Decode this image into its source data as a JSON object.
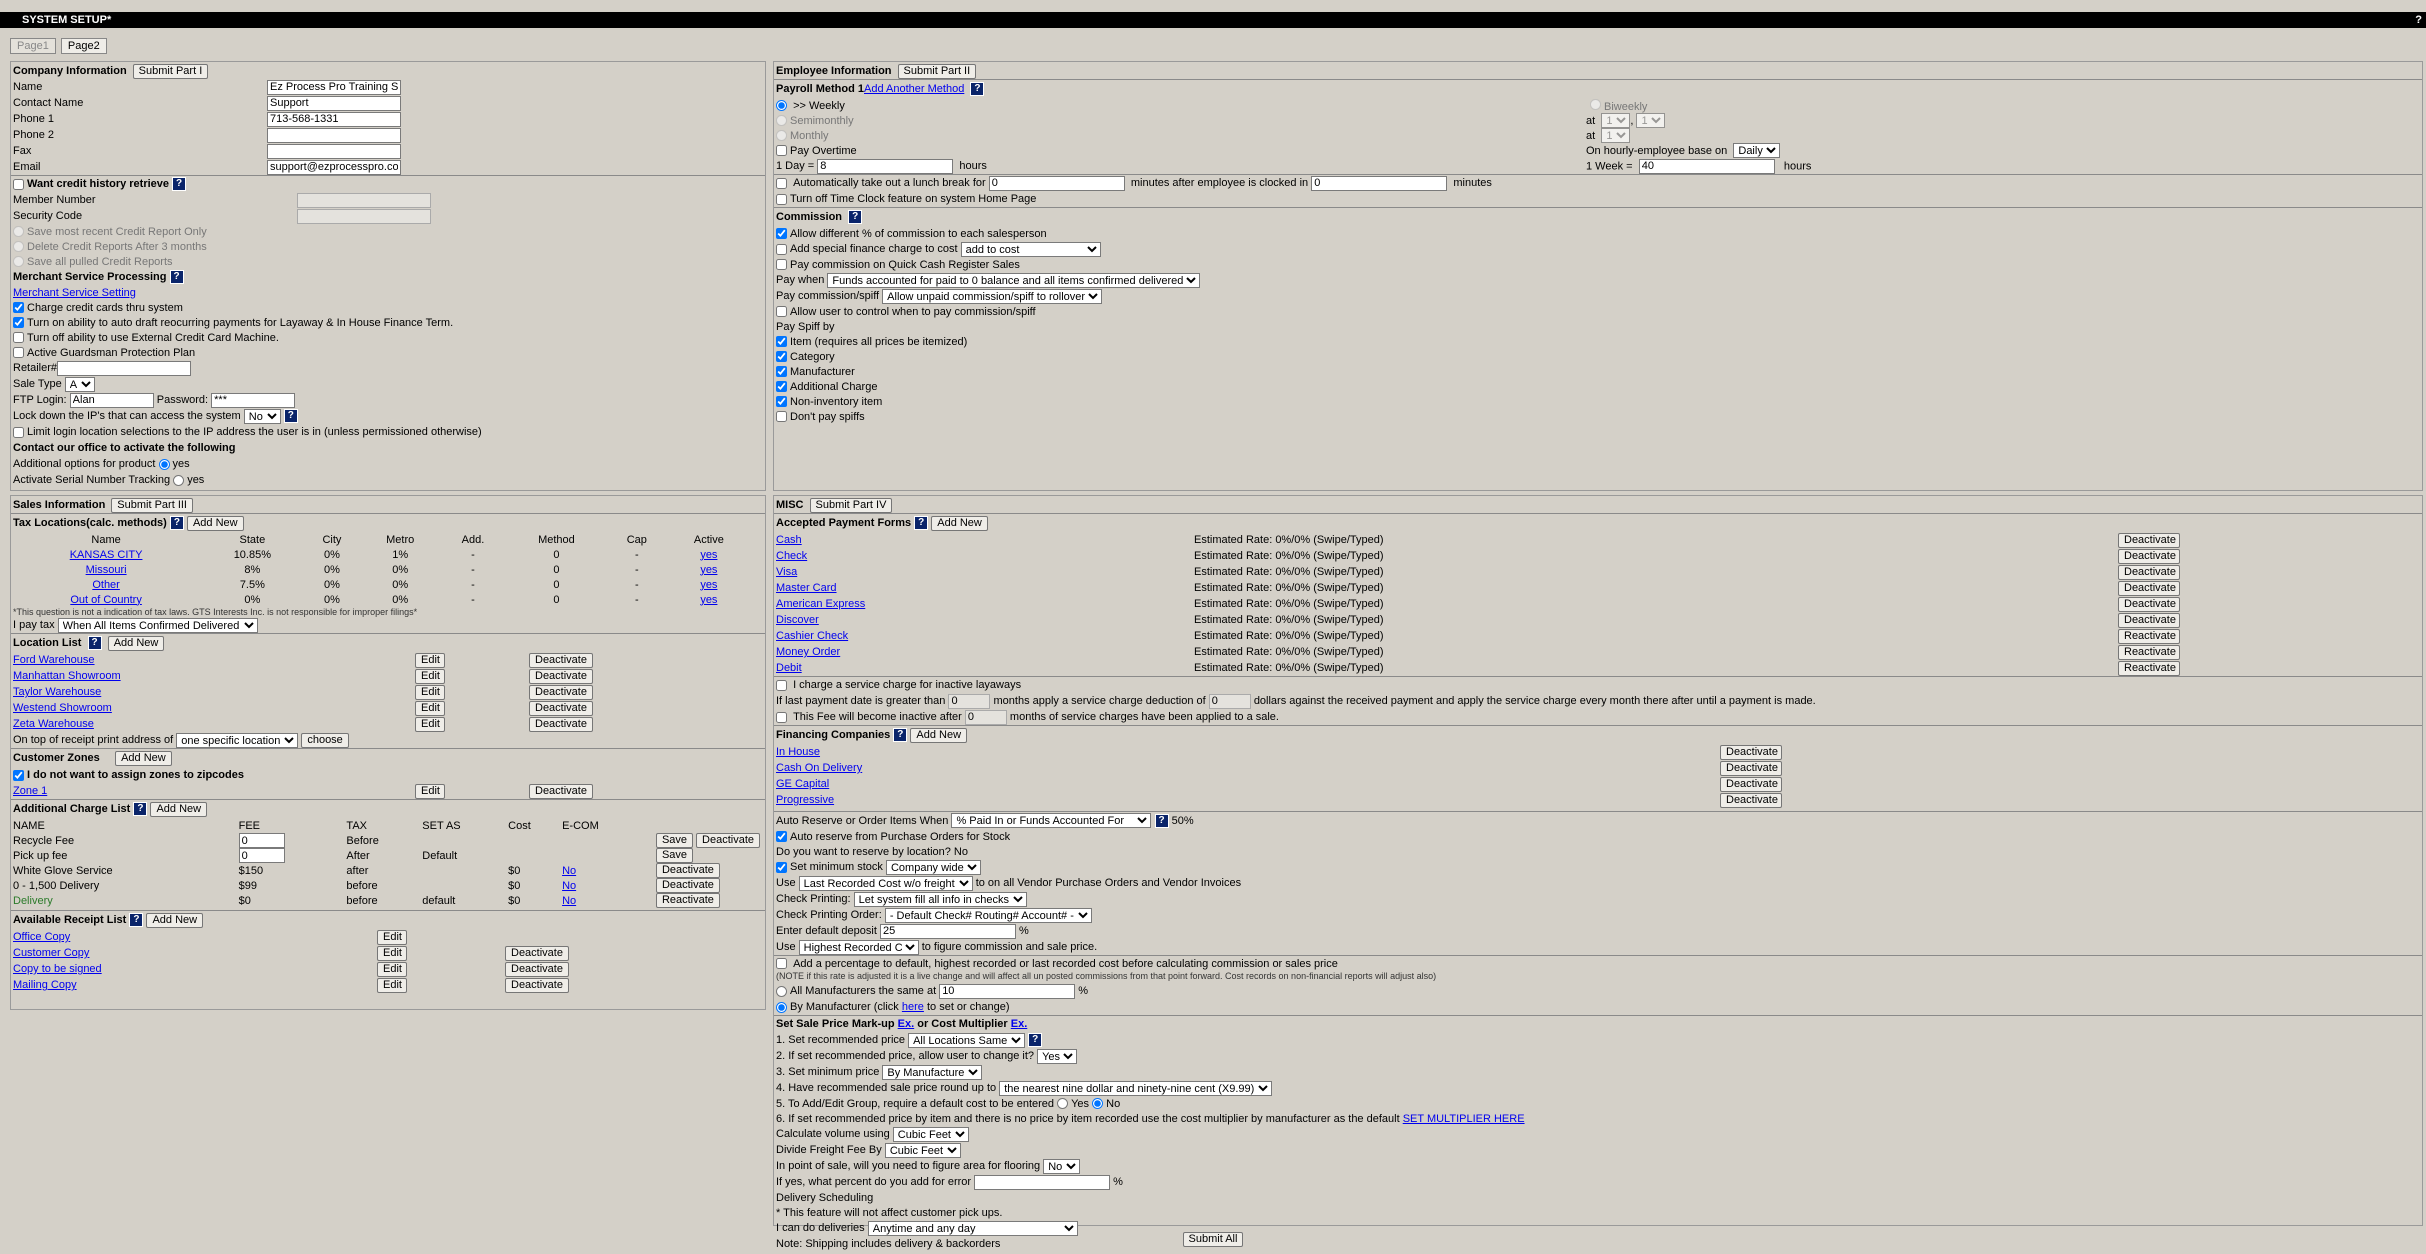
{
  "window": {
    "title": "SYSTEM SETUP*",
    "help": "?"
  },
  "tabs": [
    "Page1",
    "Page2"
  ],
  "company": {
    "header": "Company Information",
    "submit": "Submit Part I",
    "fields": [
      {
        "label": "Name",
        "value": "Ez Process Pro Training Sy"
      },
      {
        "label": "Contact Name",
        "value": "Support"
      },
      {
        "label": "Phone 1",
        "value": "713-568-1331"
      },
      {
        "label": "Phone 2",
        "value": ""
      },
      {
        "label": "Fax",
        "value": ""
      },
      {
        "label": "Email",
        "value": "support@ezprocesspro.con"
      }
    ],
    "credit": {
      "want_label": "Want credit history retrieve",
      "member_label": "Member Number",
      "security_label": "Security Code",
      "options": [
        "Save most recent Credit Report Only",
        "Delete Credit Reports After 3 months",
        "Save all pulled Credit Reports"
      ]
    },
    "merchant": {
      "header": "Merchant Service Processing",
      "link": "Merchant Service Setting",
      "checks": [
        {
          "label": "Charge credit cards thru system",
          "checked": true
        },
        {
          "label": "Turn on ability to auto draft reocurring payments for Layaway & In House Finance Term.",
          "checked": true
        },
        {
          "label": "Turn off ability to use External Credit Card Machine.",
          "checked": false
        },
        {
          "label": "Active Guardsman Protection Plan",
          "checked": false
        }
      ],
      "retailer_label": "Retailer#",
      "sale_type_label": "Sale Type",
      "sale_type_value": "A",
      "ftp_label": "FTP Login:",
      "ftp_value": "Alan",
      "password_label": "Password:",
      "password_value": "***",
      "lockdown_label": "Lock down the IP's that can access the system",
      "lockdown_value": "No",
      "limit_label": "Limit login location selections to the IP address the user is in (unless permissioned otherwise)",
      "contact_label": "Contact our office to activate the following",
      "additional_label": "Additional options for product",
      "additional_value": "yes",
      "serial_label": "Activate Serial Number Tracking",
      "serial_value": "yes"
    }
  },
  "sales": {
    "header": "Sales Information",
    "submit": "Submit Part III",
    "tax_header": "Tax Locations(calc. methods)",
    "add_new": "Add New",
    "tax_cols": [
      "Name",
      "State",
      "City",
      "Metro",
      "Add.",
      "Method",
      "Cap",
      "Active"
    ],
    "tax_rows": [
      [
        "KANSAS CITY",
        "10.85%",
        "0%",
        "1%",
        "-",
        "0",
        "-",
        "yes"
      ],
      [
        "Missouri",
        "8%",
        "0%",
        "0%",
        "-",
        "0",
        "-",
        "yes"
      ],
      [
        "Other",
        "7.5%",
        "0%",
        "0%",
        "-",
        "0",
        "-",
        "yes"
      ],
      [
        "Out of Country",
        "0%",
        "0%",
        "0%",
        "-",
        "0",
        "-",
        "yes"
      ]
    ],
    "tax_note": "*This question is not a indication of tax laws. GTS Interests Inc. is not responsible for improper filings*",
    "pay_tax_label": "I pay tax",
    "pay_tax_value": "When All Items Confirmed Delivered",
    "location_header": "Location List",
    "locations": [
      "Ford Warehouse",
      "Manhattan Showroom",
      "Taylor Warehouse",
      "Westend Showroom",
      "Zeta Warehouse"
    ],
    "edit": "Edit",
    "deactivate": "Deactivate",
    "receipt_label": "On top of receipt print address of",
    "receipt_value": "one specific location",
    "choose": "choose",
    "zones_header": "Customer Zones",
    "zones_check": "I do not want to assign zones to zipcodes",
    "zones": [
      "Zone 1"
    ],
    "charges_header": "Additional Charge List",
    "charges_cols": [
      "NAME",
      "FEE",
      "TAX",
      "SET AS",
      "Cost",
      "E-COM"
    ],
    "charges": [
      {
        "name": "Recycle Fee",
        "fee": "0",
        "tax": "Before",
        "set_as": "",
        "cost": "",
        "ecom": "",
        "actions": [
          "Save",
          "Deactivate"
        ]
      },
      {
        "name": "Pick up fee",
        "fee": "0",
        "tax": "After",
        "set_as": "Default",
        "cost": "",
        "ecom": "",
        "actions": [
          "Save"
        ]
      },
      {
        "name": "White Glove Service",
        "fee": "$150",
        "tax": "after",
        "set_as": "",
        "cost": "$0",
        "ecom": "No",
        "actions": [
          "Deactivate"
        ]
      },
      {
        "name": "0 - 1,500 Delivery",
        "fee": "$99",
        "tax": "before",
        "set_as": "",
        "cost": "$0",
        "ecom": "No",
        "actions": [
          "Deactivate"
        ]
      },
      {
        "name": "Delivery",
        "fee": "$0",
        "tax": "before",
        "set_as": "default",
        "cost": "$0",
        "ecom": "No",
        "actions": [
          "Reactivate"
        ]
      }
    ],
    "receipts_header": "Available Receipt List",
    "receipts": [
      "Office Copy",
      "Customer Copy",
      "Copy to be signed",
      "Mailing Copy"
    ]
  },
  "employee": {
    "header": "Employee Information",
    "submit": "Submit Part II",
    "payroll_header": "Payroll Method 1",
    "add_method": "Add Another Method",
    "weekly": ">> Weekly",
    "biweekly": "Biweekly",
    "semimonthly": "Semimonthly",
    "at": "at",
    "semi_a": "1",
    "semi_b": "1",
    "monthly": "Monthly",
    "monthly_at": "1",
    "overtime": "Pay Overtime",
    "hourly_label": "On hourly-employee base on",
    "hourly_value": "Daily",
    "day_label": "1 Day =",
    "day_value": "8",
    "hours": "hours",
    "week_label": "1 Week =",
    "week_value": "40",
    "lunch_a": "Automatically take out a lunch break for",
    "lunch_v1": "0",
    "lunch_b": "minutes after employee is clocked in",
    "lunch_v2": "0",
    "minutes": "minutes",
    "timeclock": "Turn off Time Clock feature on system Home Page",
    "commission_header": "Commission",
    "comm_allow": "Allow different % of commission to each salesperson",
    "comm_finance": "Add special finance charge to cost",
    "comm_finance_value": "add to cost",
    "comm_quick": "Pay commission on Quick Cash Register Sales",
    "pay_when_label": "Pay when",
    "pay_when_value": "Funds accounted for paid to 0 balance and all items confirmed delivered",
    "spiff_label": "Pay commission/spiff",
    "spiff_value": "Allow unpaid commission/spiff to rollover",
    "allow_user": "Allow user to control when to pay commission/spiff",
    "spiff_by": "Pay Spiff by",
    "spiff_items": [
      {
        "label": "Item (requires all prices be itemized)",
        "checked": true
      },
      {
        "label": "Category",
        "checked": true
      },
      {
        "label": "Manufacturer",
        "checked": true
      },
      {
        "label": "Additional Charge",
        "checked": true
      },
      {
        "label": "Non-inventory item",
        "checked": true
      },
      {
        "label": "Don't pay spiffs",
        "checked": false
      }
    ]
  },
  "misc": {
    "header": "MISC",
    "submit": "Submit Part IV",
    "payment_header": "Accepted Payment Forms",
    "add_new": "Add New",
    "payments": [
      {
        "name": "Cash",
        "rate": "Estimated Rate: 0%/0% (Swipe/Typed)",
        "action": "Deactivate"
      },
      {
        "name": "Check",
        "rate": "Estimated Rate: 0%/0% (Swipe/Typed)",
        "action": "Deactivate"
      },
      {
        "name": "Visa",
        "rate": "Estimated Rate: 0%/0% (Swipe/Typed)",
        "action": "Deactivate"
      },
      {
        "name": "Master Card",
        "rate": "Estimated Rate: 0%/0% (Swipe/Typed)",
        "action": "Deactivate"
      },
      {
        "name": "American Express",
        "rate": "Estimated Rate: 0%/0% (Swipe/Typed)",
        "action": "Deactivate"
      },
      {
        "name": "Discover",
        "rate": "Estimated Rate: 0%/0% (Swipe/Typed)",
        "action": "Deactivate"
      },
      {
        "name": "Cashier Check",
        "rate": "Estimated Rate: 0%/0% (Swipe/Typed)",
        "action": "Reactivate"
      },
      {
        "name": "Money Order",
        "rate": "Estimated Rate: 0%/0% (Swipe/Typed)",
        "action": "Reactivate"
      },
      {
        "name": "Debit",
        "rate": "Estimated Rate: 0%/0% (Swipe/Typed)",
        "action": "Reactivate"
      }
    ],
    "layaway_check": "I charge a service charge for inactive layaways",
    "layaway_a": "If last payment date is greater than",
    "layaway_v1": "0",
    "layaway_b": "months apply a service charge deduction of",
    "layaway_v2": "0",
    "layaway_c": "dollars against the received payment and apply the service charge every month there after until a payment is made.",
    "fee_inactive_a": "This Fee will become inactive after",
    "fee_inactive_v": "0",
    "fee_inactive_b": "months of service charges have been applied to a sale.",
    "financing_header": "Financing Companies",
    "financing": [
      "In House",
      "Cash On Delivery",
      "GE Capital",
      "Progressive"
    ],
    "auto_reserve_label": "Auto Reserve or Order Items When",
    "auto_reserve_value": "% Paid In or Funds Accounted For",
    "auto_reserve_pct": "50%",
    "auto_reserve_po": "Auto reserve from Purchase Orders for Stock",
    "reserve_location": "Do you want to reserve by location? No",
    "min_stock": "Set minimum stock",
    "min_stock_value": "Company wide",
    "use_label": "Use",
    "use_value": "Last Recorded Cost w/o freight",
    "use_suffix": "to on all Vendor Purchase Orders and Vendor Invoices",
    "check_printing_label": "Check Printing:",
    "check_printing_value": "Let system fill all info in checks",
    "check_order_label": "Check Printing Order:",
    "check_order_value": "- Default  Check# Routing# Account# -",
    "deposit_label": "Enter default deposit",
    "deposit_value": "25",
    "pct": "%",
    "use2_value": "Highest Recorded Cost",
    "use2_suffix": "to figure commission and sale price.",
    "add_pct": "Add a percentage to default, highest recorded or last recorded cost before calculating commission or sales price",
    "add_pct_note": "(NOTE if this rate is adjusted it is a live change and will affect all un posted commissions from that point forward. Cost records on non-financial reports will adjust also)",
    "all_mfr": "All Manufacturers the same at",
    "all_mfr_value": "10",
    "by_mfr_a": "By Manufacturer (click",
    "by_mfr_here": "here",
    "by_mfr_b": "to set or change)",
    "markup_header": "Set Sale Price Mark-up",
    "ex": "Ex.",
    "or_cost": "or Cost Multiplier",
    "set1": "1. Set recommended price",
    "set1_value": "All Locations Same",
    "set2": "2. If set recommended price, allow user to change it?",
    "set2_value": "Yes",
    "set3": "3. Set minimum price",
    "set3_value": "By Manufacture",
    "set4": "4. Have recommended sale price round up to",
    "set4_value": "the nearest nine dollar and ninety-nine cent (X9.99)",
    "set5": "5. To Add/Edit Group, require a default cost to be entered",
    "yes": "Yes",
    "no": "No",
    "set6": "6. If set recommended price by item and there is no price by item recorded use the cost multiplier by manufacturer as the default",
    "set6_link": "SET MULTIPLIER HERE",
    "volume_label": "Calculate volume using",
    "volume_value": "Cubic Feet",
    "freight_label": "Divide Freight Fee By",
    "freight_value": "Cubic Feet",
    "flooring_label": "In point of sale, will you need to figure area for flooring",
    "flooring_value": "No",
    "error_label": "If yes, what percent do you add for error",
    "delivery_sched": "Delivery Scheduling",
    "delivery_note": "* This feature will not affect customer pick ups.",
    "deliveries_label": "I can do deliveries",
    "deliveries_value": "Anytime and any day",
    "shipping_note": "Note: Shipping includes delivery & backorders"
  },
  "submit_all": "Submit All"
}
